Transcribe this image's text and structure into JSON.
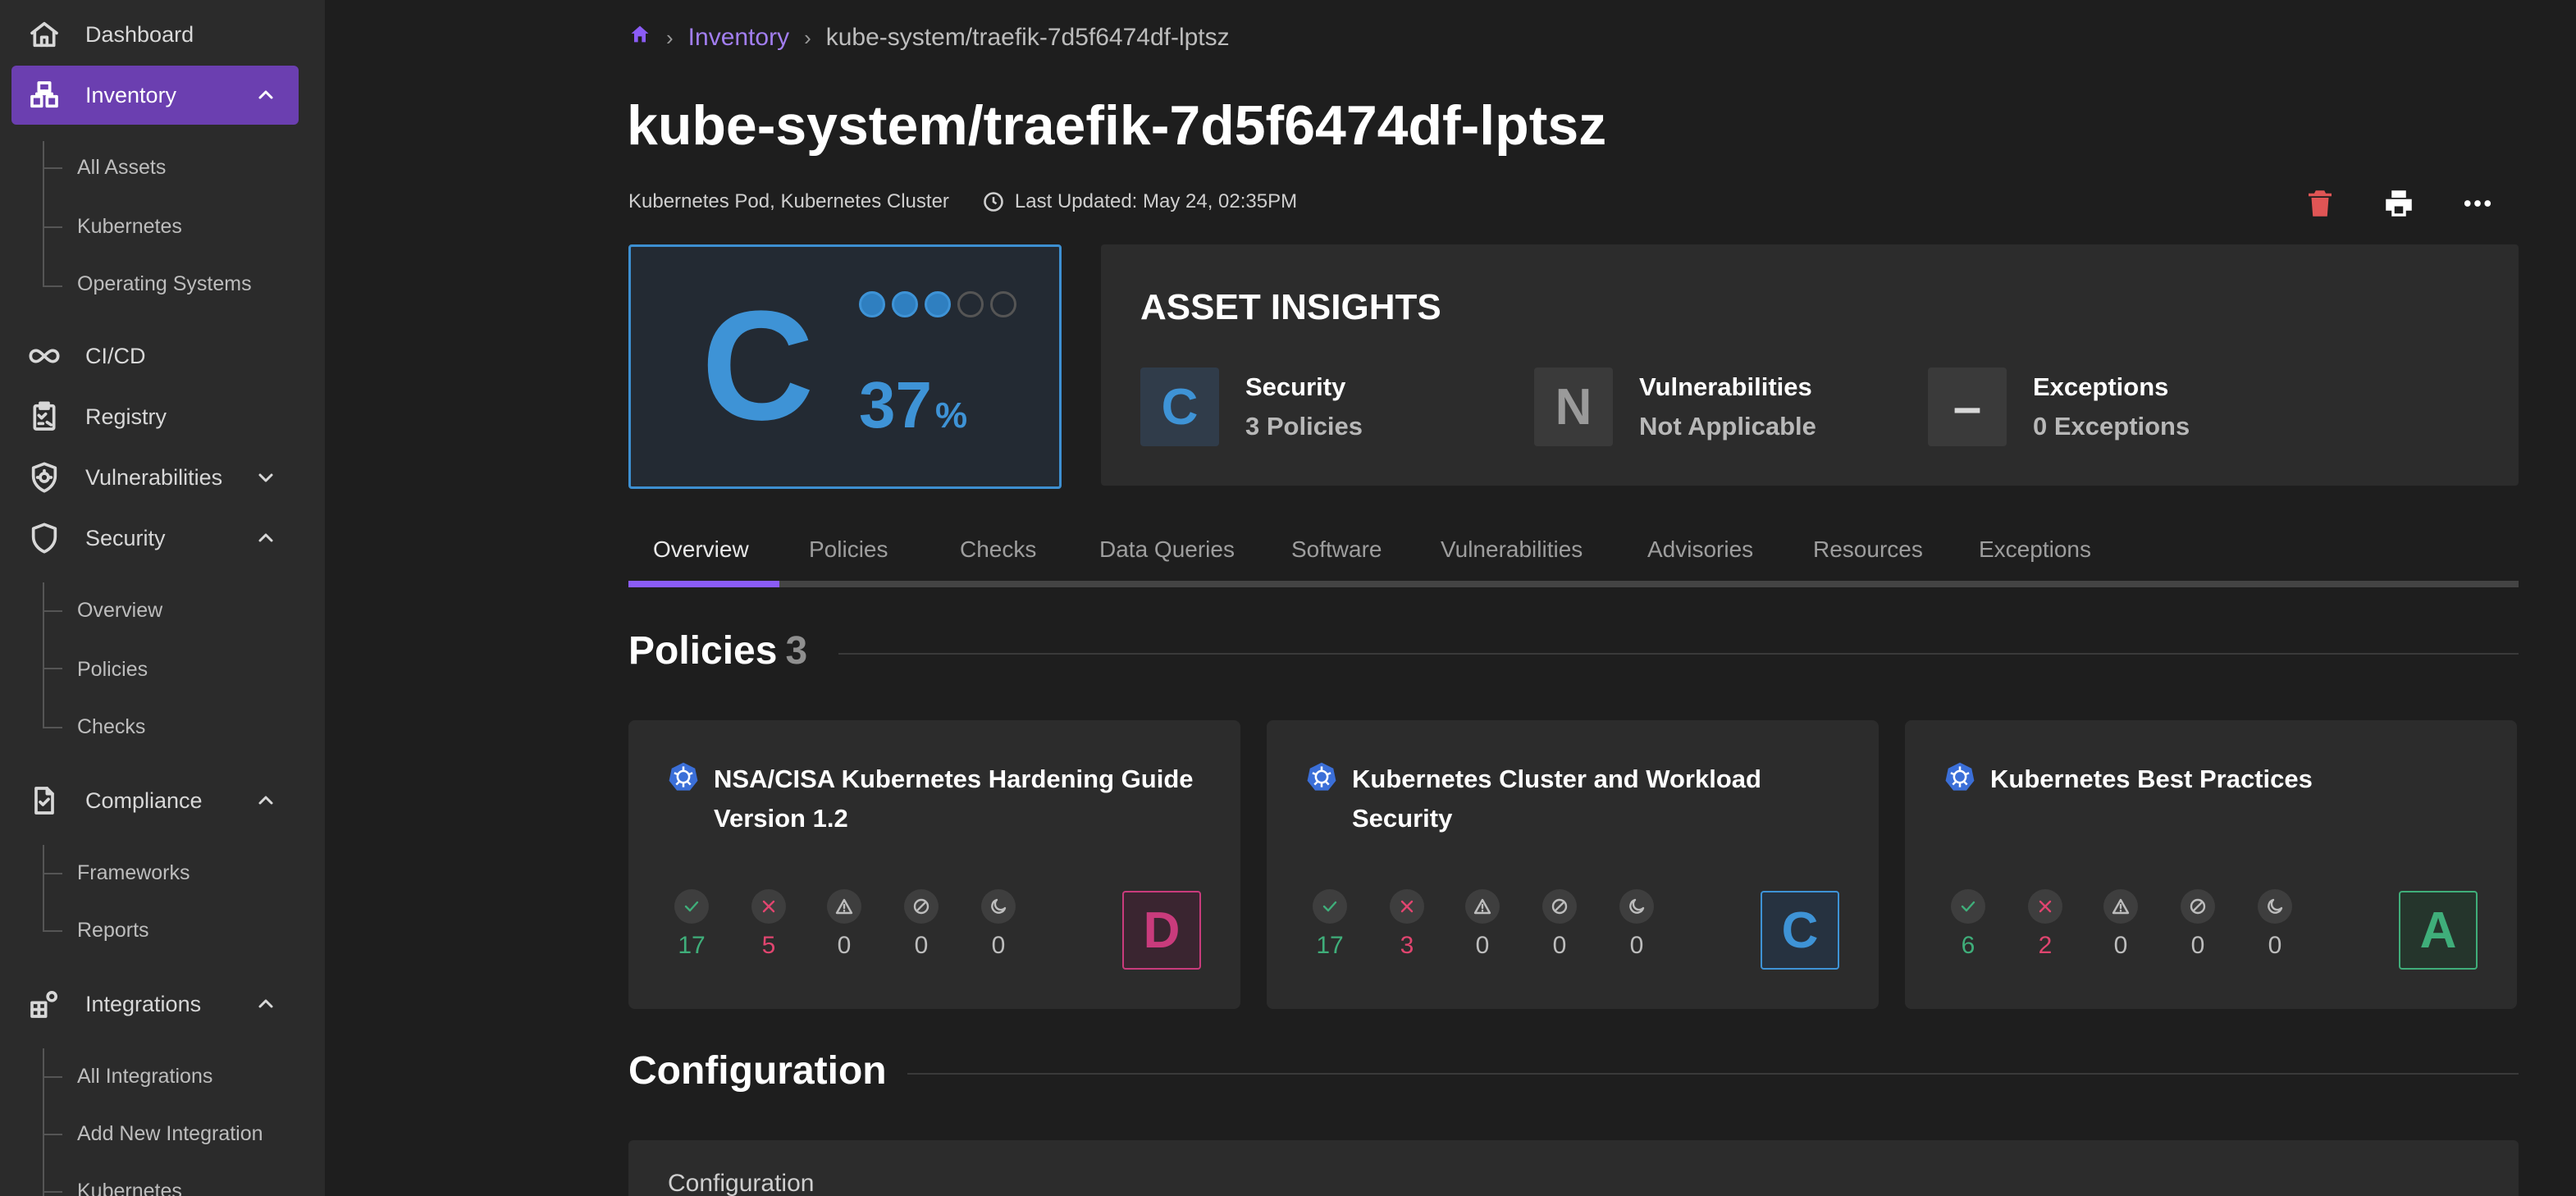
{
  "sidebar": {
    "items": [
      {
        "label": "Dashboard",
        "icon": "home-icon"
      },
      {
        "label": "Inventory",
        "icon": "inventory-icon"
      },
      {
        "label": "CI/CD",
        "icon": "infinity-icon"
      },
      {
        "label": "Registry",
        "icon": "clipboard-icon"
      },
      {
        "label": "Vulnerabilities",
        "icon": "bug-shield-icon"
      },
      {
        "label": "Security",
        "icon": "shield-icon"
      },
      {
        "label": "Compliance",
        "icon": "document-check-icon"
      },
      {
        "label": "Integrations",
        "icon": "integrations-icon"
      }
    ],
    "inventory_sub": [
      "All Assets",
      "Kubernetes",
      "Operating Systems"
    ],
    "security_sub": [
      "Overview",
      "Policies",
      "Checks"
    ],
    "compliance_sub": [
      "Frameworks",
      "Reports"
    ],
    "integrations_sub": [
      "All Integrations",
      "Add New Integration",
      "Kubernetes"
    ]
  },
  "breadcrumb": {
    "inventory": "Inventory",
    "current": "kube-system/traefik-7d5f6474df-lptsz"
  },
  "header": {
    "title": "kube-system/traefik-7d5f6474df-lptsz",
    "types": "Kubernetes Pod, Kubernetes Cluster",
    "last_updated": "Last Updated: May 24, 02:35PM"
  },
  "score": {
    "grade": "C",
    "percent": "37",
    "percent_sign": "%",
    "dots_filled": 3,
    "dots_total": 5
  },
  "insights": {
    "title": "ASSET INSIGHTS",
    "security": {
      "box": "C",
      "head": "Security",
      "sub": "3 Policies"
    },
    "vulnerabilities": {
      "box": "N",
      "head": "Vulnerabilities",
      "sub": "Not Applicable"
    },
    "exceptions": {
      "box": "–",
      "head": "Exceptions",
      "sub": "0 Exceptions"
    }
  },
  "tabs": [
    "Overview",
    "Policies",
    "Checks",
    "Data Queries",
    "Software",
    "Vulnerabilities",
    "Advisories",
    "Resources",
    "Exceptions"
  ],
  "policies_section": {
    "title": "Policies",
    "count": "3"
  },
  "policies": [
    {
      "title": "NSA/CISA Kubernetes Hardening Guide Version 1.2",
      "pass": "17",
      "fail": "5",
      "warn": "0",
      "skip": "0",
      "snooze": "0",
      "grade": "D"
    },
    {
      "title": "Kubernetes Cluster and Workload Security",
      "pass": "17",
      "fail": "3",
      "warn": "0",
      "skip": "0",
      "snooze": "0",
      "grade": "C"
    },
    {
      "title": "Kubernetes Best Practices",
      "pass": "6",
      "fail": "2",
      "warn": "0",
      "skip": "0",
      "snooze": "0",
      "grade": "A"
    }
  ],
  "configuration_section": {
    "title": "Configuration",
    "card_label": "Configuration"
  },
  "colors": {
    "accent": "#8b5cf6",
    "grade_c": "#3e93d6",
    "grade_d": "#c93b7c",
    "grade_a": "#3fae7a",
    "pass": "#3fae7a",
    "fail": "#e0456f",
    "delete": "#e05555"
  }
}
